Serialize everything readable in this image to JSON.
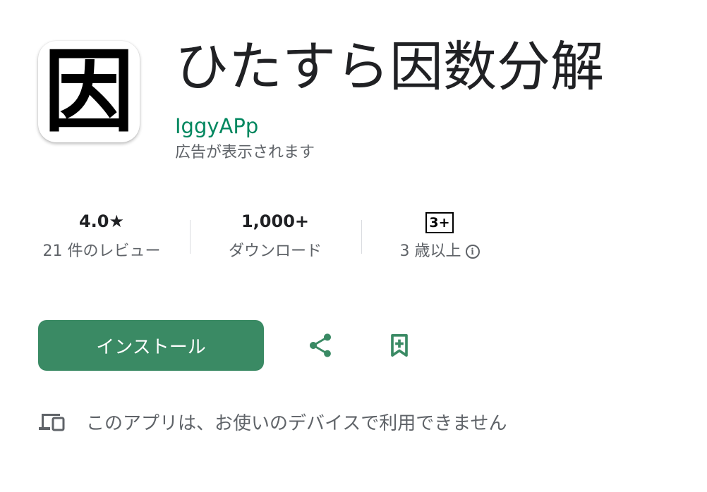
{
  "app": {
    "icon_glyph": "因",
    "title": "ひたすら因数分解",
    "developer": "IggyAPp",
    "ads_notice": "広告が表示されます"
  },
  "stats": {
    "rating": {
      "value": "4.0★",
      "label": "21 件のレビュー"
    },
    "downloads": {
      "value": "1,000+",
      "label": "ダウンロード"
    },
    "content_rating": {
      "badge": "3+",
      "label": "3 歳以上",
      "info_icon": "i"
    }
  },
  "actions": {
    "install_label": "インストール",
    "share_icon": "share-icon",
    "wishlist_icon": "bookmark-add-icon"
  },
  "compatibility": {
    "icon": "devices-icon",
    "text": "このアプリは、お使いのデバイスで利用できません"
  },
  "colors": {
    "accent": "#01875f",
    "install_button": "#3a8a64",
    "secondary_text": "#5f6368",
    "primary_text": "#202124"
  }
}
